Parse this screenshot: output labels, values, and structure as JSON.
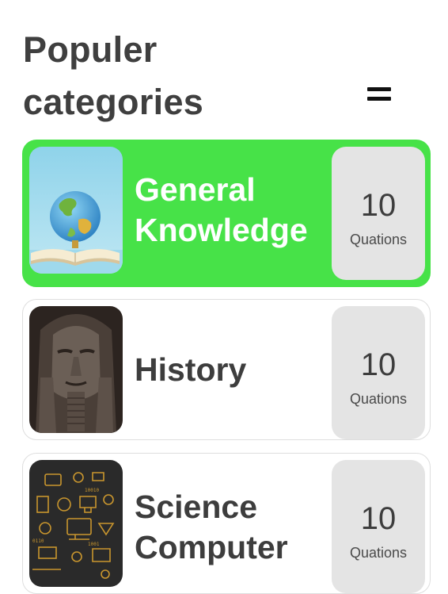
{
  "header": {
    "title": "Populer\ncategories",
    "menu_icon": "hamburger-menu-icon"
  },
  "categories": [
    {
      "name": "General\nKnowledge",
      "count": "10",
      "unit": "Quations",
      "selected": true,
      "image": "globe-on-book-image"
    },
    {
      "name": "History",
      "count": "10",
      "unit": "Quations",
      "selected": false,
      "image": "pharaoh-statue-image"
    },
    {
      "name": "Science\nComputer",
      "count": "10",
      "unit": "Quations",
      "selected": false,
      "image": "tech-doodle-image"
    }
  ],
  "colors": {
    "selected_card": "#47e248",
    "count_box": "#e4e4e4",
    "title_text": "#3f3f3f"
  }
}
